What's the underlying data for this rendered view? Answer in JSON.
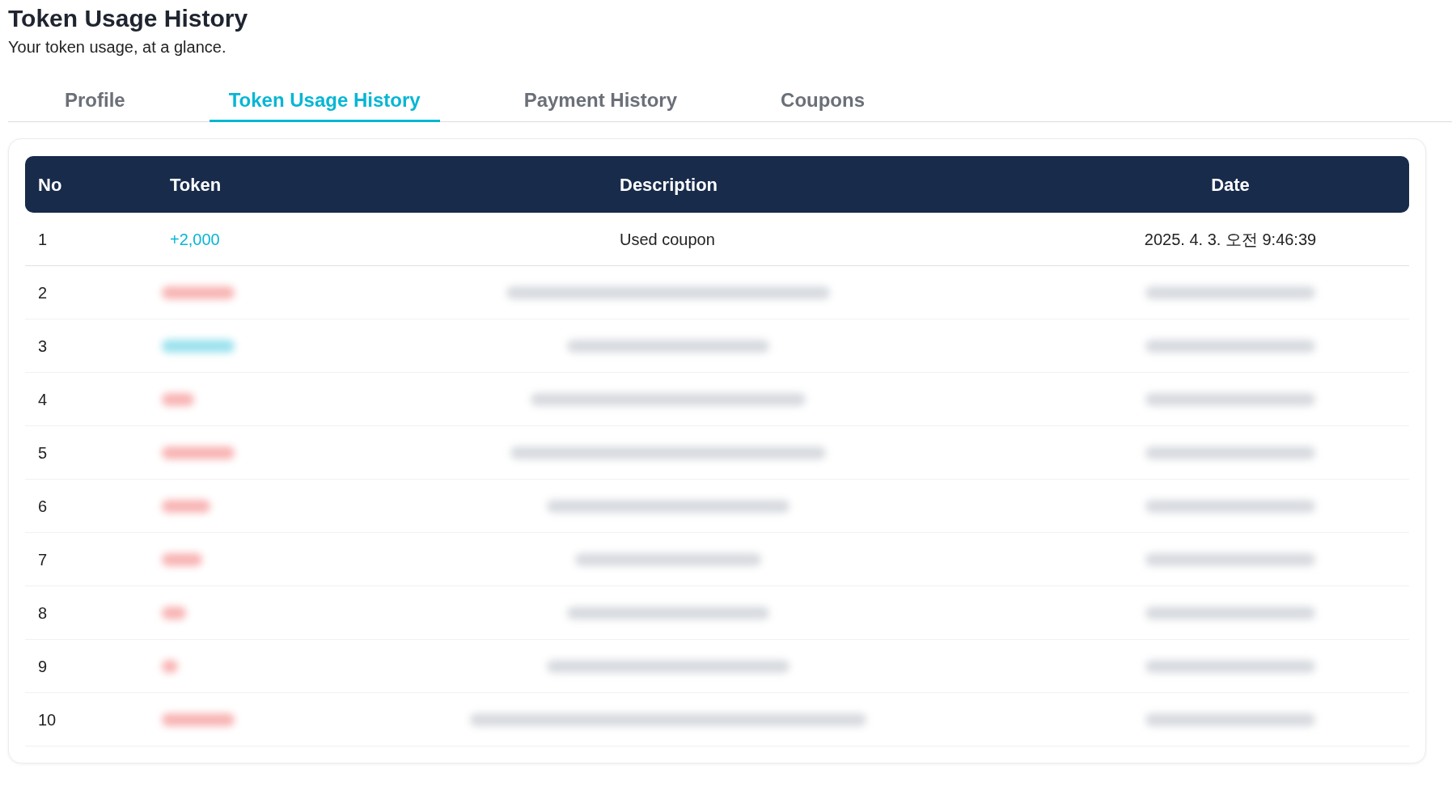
{
  "header": {
    "title": "Token Usage History",
    "subtitle": "Your token usage, at a glance."
  },
  "tabs": [
    {
      "label": "Profile",
      "selected": false
    },
    {
      "label": "Token Usage History",
      "selected": true
    },
    {
      "label": "Payment History",
      "selected": false
    },
    {
      "label": "Coupons",
      "selected": false
    }
  ],
  "table": {
    "columns": [
      "No",
      "Token",
      "Description",
      "Date"
    ],
    "rows": [
      {
        "no": "1",
        "redacted": false,
        "token": "+2,000",
        "color": "#06b6d4",
        "description": "Used coupon",
        "date": "2025. 4. 3. 오전 9:46:39"
      },
      {
        "no": "2",
        "redacted": true,
        "kind": "loss"
      },
      {
        "no": "3",
        "redacted": true,
        "kind": "gain"
      },
      {
        "no": "4",
        "redacted": true,
        "kind": "loss"
      },
      {
        "no": "5",
        "redacted": true,
        "kind": "loss"
      },
      {
        "no": "6",
        "redacted": true,
        "kind": "loss"
      },
      {
        "no": "7",
        "redacted": true,
        "kind": "loss"
      },
      {
        "no": "8",
        "redacted": true,
        "kind": "loss"
      },
      {
        "no": "9",
        "redacted": true,
        "kind": "loss"
      },
      {
        "no": "10",
        "redacted": true,
        "kind": "loss"
      }
    ]
  }
}
